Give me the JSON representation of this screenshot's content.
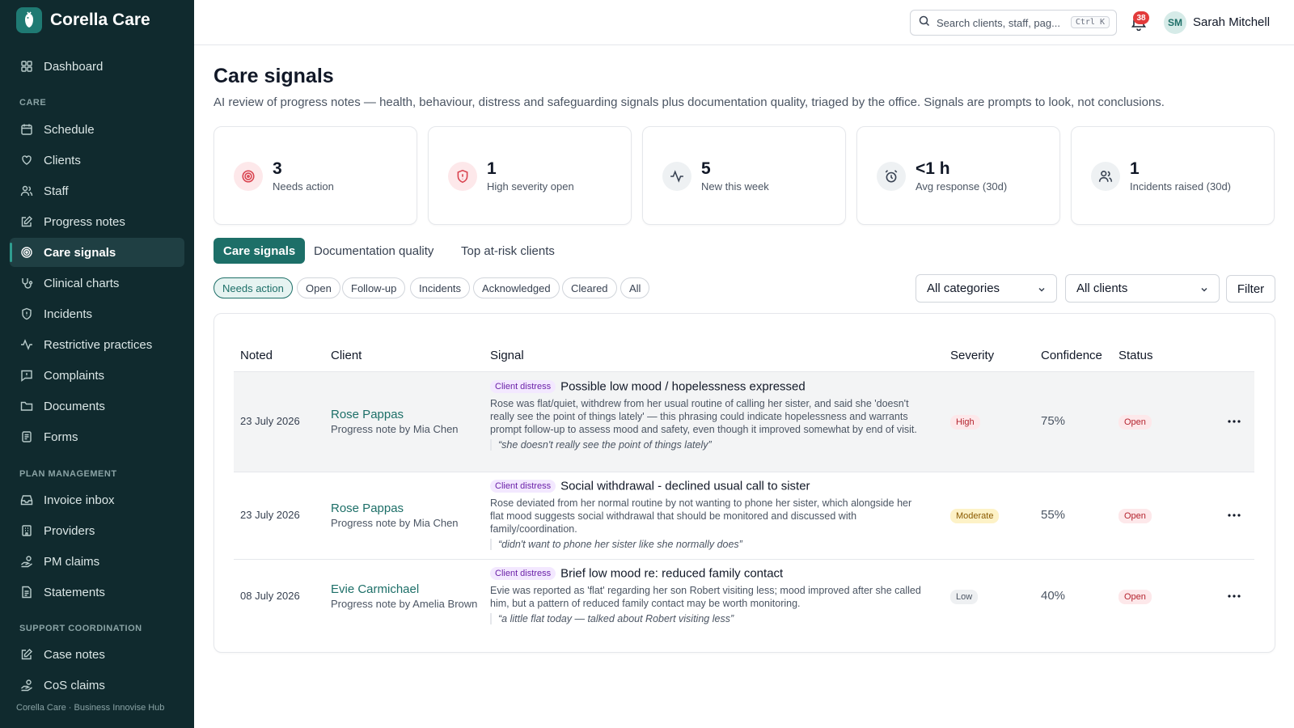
{
  "brand": {
    "name": "Corella Care"
  },
  "nav": {
    "items": [
      {
        "key": "dashboard",
        "label": "Dashboard",
        "icon": "dashboard-icon"
      },
      {
        "key": "schedule",
        "label": "Schedule",
        "icon": "calendar-icon"
      },
      {
        "key": "clients",
        "label": "Clients",
        "icon": "heart-hand-icon"
      },
      {
        "key": "staff",
        "label": "Staff",
        "icon": "users-icon"
      },
      {
        "key": "progress-notes",
        "label": "Progress notes",
        "icon": "edit-note-icon"
      },
      {
        "key": "care-signals",
        "label": "Care signals",
        "icon": "target-icon",
        "active": true
      },
      {
        "key": "clinical-charts",
        "label": "Clinical charts",
        "icon": "stethoscope-icon"
      },
      {
        "key": "incidents",
        "label": "Incidents",
        "icon": "shield-icon"
      },
      {
        "key": "restrictive-practices",
        "label": "Restrictive practices",
        "icon": "activity-icon"
      },
      {
        "key": "complaints",
        "label": "Complaints",
        "icon": "message-alert-icon"
      },
      {
        "key": "documents",
        "label": "Documents",
        "icon": "folder-icon"
      },
      {
        "key": "forms",
        "label": "Forms",
        "icon": "form-icon"
      },
      {
        "key": "invoice-inbox",
        "label": "Invoice inbox",
        "icon": "inbox-icon"
      },
      {
        "key": "providers",
        "label": "Providers",
        "icon": "building-icon"
      },
      {
        "key": "pm-claims",
        "label": "PM claims",
        "icon": "hand-coins-icon"
      },
      {
        "key": "statements",
        "label": "Statements",
        "icon": "file-text-icon"
      },
      {
        "key": "case-notes",
        "label": "Case notes",
        "icon": "edit-note-icon"
      },
      {
        "key": "cos-claims",
        "label": "CoS claims",
        "icon": "hand-coins-icon"
      }
    ],
    "sections": {
      "care": "CARE",
      "plan_management": "PLAN MANAGEMENT",
      "support_coordination": "SUPPORT COORDINATION"
    },
    "footer": "Corella Care · Business Innovise Hub"
  },
  "topbar": {
    "search_placeholder": "Search clients, staff, pag...",
    "shortcut": "Ctrl K",
    "notifications_count": "38",
    "user_initials": "SM",
    "user_name": "Sarah Mitchell"
  },
  "page": {
    "title": "Care signals",
    "subtitle": "AI review of progress notes — health, behaviour, distress and safeguarding signals plus documentation quality, triaged by the office. Signals are prompts to look, not conclusions."
  },
  "stats": [
    {
      "value": "3",
      "label": "Needs action",
      "icon": "target-icon",
      "bg": "#fde8ea",
      "fg": "#d9434f"
    },
    {
      "value": "1",
      "label": "High severity open",
      "icon": "shield-icon",
      "bg": "#fde8ea",
      "fg": "#d9434f"
    },
    {
      "value": "5",
      "label": "New this week",
      "icon": "activity-icon",
      "bg": "#eef1f3",
      "fg": "#374151"
    },
    {
      "value": "<1 h",
      "label": "Avg response (30d)",
      "icon": "alarm-clock-icon",
      "bg": "#eef1f3",
      "fg": "#374151"
    },
    {
      "value": "1",
      "label": "Incidents raised (30d)",
      "icon": "users-icon",
      "bg": "#eef1f3",
      "fg": "#374151"
    }
  ],
  "tabs": [
    {
      "label": "Care signals",
      "active": true
    },
    {
      "label": "Documentation quality"
    },
    {
      "label": "Top at-risk clients"
    }
  ],
  "filters": {
    "chips": [
      {
        "label": "Needs action",
        "active": true
      },
      {
        "label": "Open"
      },
      {
        "label": "Follow-up"
      },
      {
        "label": "Incidents"
      },
      {
        "label": "Acknowledged"
      },
      {
        "label": "Cleared"
      },
      {
        "label": "All"
      }
    ],
    "category_select": "All categories",
    "client_select": "All clients",
    "filter_button": "Filter"
  },
  "table": {
    "headers": {
      "noted": "Noted",
      "client": "Client",
      "signal": "Signal",
      "severity": "Severity",
      "confidence": "Confidence",
      "status": "Status"
    },
    "rows": [
      {
        "noted": "23 July 2026",
        "client": "Rose Pappas",
        "author": "Progress note by Mia Chen",
        "category": "Client distress",
        "title": "Possible low mood / hopelessness expressed",
        "description": "Rose was flat/quiet, withdrew from her usual routine of calling her sister, and said she 'doesn't really see the point of things lately' — this phrasing could indicate hopelessness and warrants prompt follow-up to assess mood and safety, even though it improved somewhat by end of visit.",
        "quote": "“she doesn't really see the point of things lately”",
        "severity": "High",
        "severity_level": "high",
        "confidence": "75%",
        "status": "Open"
      },
      {
        "noted": "23 July 2026",
        "client": "Rose Pappas",
        "author": "Progress note by Mia Chen",
        "category": "Client distress",
        "title": "Social withdrawal - declined usual call to sister",
        "description": "Rose deviated from her normal routine by not wanting to phone her sister, which alongside her flat mood suggests social withdrawal that should be monitored and discussed with family/coordination.",
        "quote": "“didn't want to phone her sister like she normally does”",
        "severity": "Moderate",
        "severity_level": "moderate",
        "confidence": "55%",
        "status": "Open"
      },
      {
        "noted": "08 July 2026",
        "client": "Evie Carmichael",
        "author": "Progress note by Amelia Brown",
        "category": "Client distress",
        "title": "Brief low mood re: reduced family contact",
        "description": "Evie was reported as 'flat' regarding her son Robert visiting less; mood improved after she called him, but a pattern of reduced family contact may be worth monitoring.",
        "quote": "“a little flat today — talked about Robert visiting less”",
        "severity": "Low",
        "severity_level": "low",
        "confidence": "40%",
        "status": "Open"
      }
    ]
  }
}
